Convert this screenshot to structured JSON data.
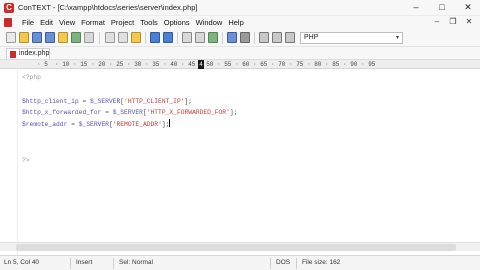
{
  "window": {
    "title": "ConTEXT - [C:\\xampp\\htdocs\\series\\server\\index.php]",
    "controls": [
      "–",
      "□",
      "✕"
    ]
  },
  "menubar": {
    "items": [
      "File",
      "Edit",
      "View",
      "Format",
      "Project",
      "Tools",
      "Options",
      "Window",
      "Help"
    ],
    "mdi_controls": [
      "–",
      "❐",
      "✕"
    ]
  },
  "toolbar": {
    "highlighter_value": "PHP",
    "highlighter_arrow": "▾"
  },
  "tabs": [
    {
      "label": "index.php",
      "active": true
    }
  ],
  "ruler": {
    "ticks": [
      "5",
      "10",
      "15",
      "20",
      "25",
      "30",
      "35",
      "40",
      "45",
      "50",
      "55",
      "60",
      "65",
      "70",
      "75",
      "80",
      "85",
      "90",
      "95"
    ],
    "caret_column": "4"
  },
  "editor": {
    "lines": [
      {
        "segments": [
          {
            "t": "<?php",
            "c": "c-tag"
          }
        ]
      },
      {
        "segments": []
      },
      {
        "segments": [
          {
            "t": "$http_client_ip",
            "c": "c-var"
          },
          {
            "t": " = ",
            "c": "c-op"
          },
          {
            "t": "$_SERVER",
            "c": "c-var"
          },
          {
            "t": "[",
            "c": "c-brk"
          },
          {
            "t": "'HTTP_CLIENT_IP'",
            "c": "c-str"
          },
          {
            "t": "];",
            "c": "c-brk"
          }
        ]
      },
      {
        "segments": [
          {
            "t": "$http_x_forwarded_for",
            "c": "c-var"
          },
          {
            "t": " = ",
            "c": "c-op"
          },
          {
            "t": "$_SERVER",
            "c": "c-var"
          },
          {
            "t": "[",
            "c": "c-brk"
          },
          {
            "t": "'HTTP_X_FORWARDED_FOR'",
            "c": "c-str"
          },
          {
            "t": "];",
            "c": "c-brk"
          }
        ]
      },
      {
        "segments": [
          {
            "t": "$remote_addr",
            "c": "c-var"
          },
          {
            "t": " = ",
            "c": "c-op"
          },
          {
            "t": "$_SERVER",
            "c": "c-var"
          },
          {
            "t": "[",
            "c": "c-brk"
          },
          {
            "t": "'REMOTE_ADDR'",
            "c": "c-str"
          },
          {
            "t": "];",
            "c": "c-brk"
          }
        ],
        "cursor": true
      },
      {
        "segments": []
      },
      {
        "segments": []
      },
      {
        "segments": [
          {
            "t": "?>",
            "c": "c-tag"
          }
        ]
      }
    ]
  },
  "statusbar": {
    "position": "Ln 5, Col 40",
    "mode": "Insert",
    "selection": "Sel: Normal",
    "line_ending": "DOS",
    "file_size": "File size: 162"
  },
  "colors": {
    "brand_red": "#cc2b2b",
    "variable": "#5a4fb8",
    "string": "#c23a3a",
    "php_tag": "#9a9a9a"
  }
}
